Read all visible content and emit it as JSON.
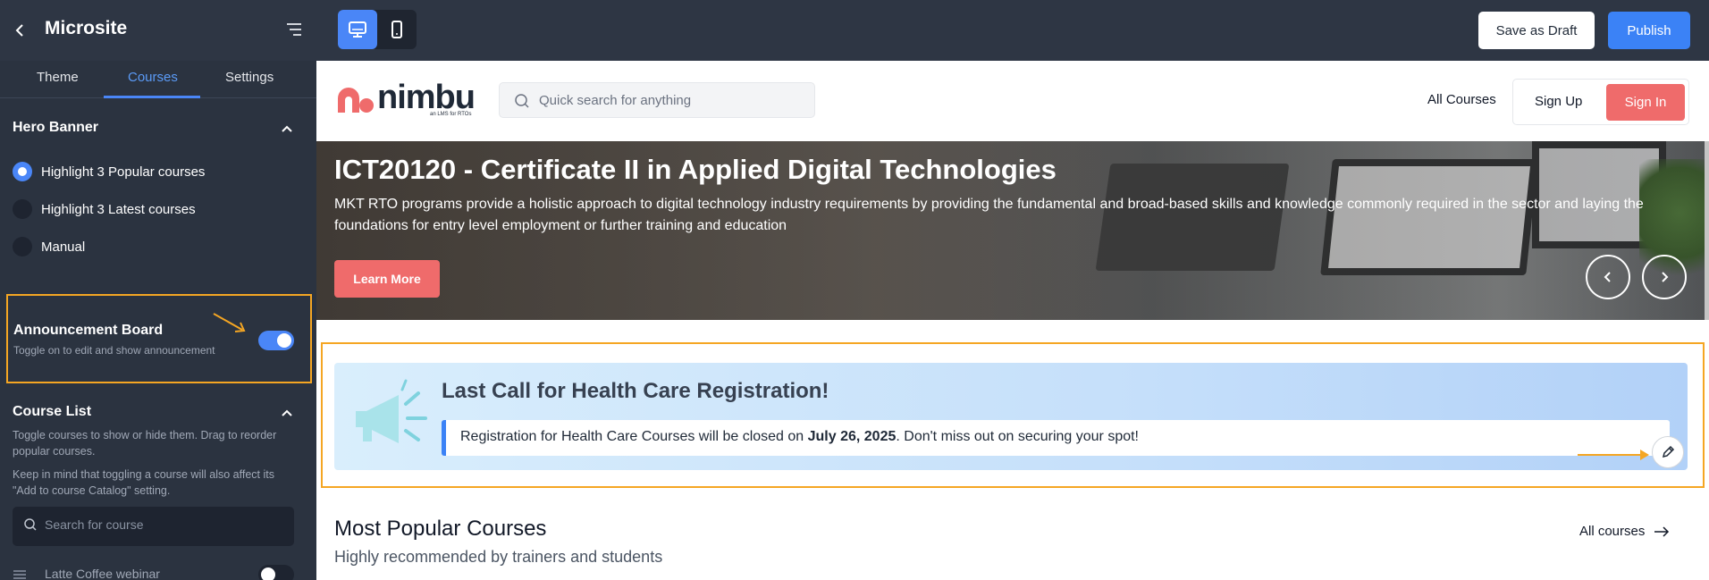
{
  "app": {
    "title": "Microsite",
    "save_draft_label": "Save as Draft",
    "publish_label": "Publish"
  },
  "sidebar": {
    "tabs": [
      {
        "label": "Theme"
      },
      {
        "label": "Courses",
        "active": true
      },
      {
        "label": "Settings"
      }
    ],
    "hero_banner": {
      "title": "Hero Banner",
      "options": [
        {
          "label": "Highlight 3 Popular courses",
          "checked": true
        },
        {
          "label": "Highlight 3 Latest courses",
          "checked": false
        },
        {
          "label": "Manual",
          "checked": false
        }
      ]
    },
    "announcement": {
      "title": "Announcement Board",
      "subtitle": "Toggle on to edit and show announcement",
      "enabled": true
    },
    "course_list": {
      "title": "Course List",
      "desc1": "Toggle courses to show or hide them. Drag to reorder popular courses.",
      "desc2": "Keep in mind that toggling a course will also affect its \"Add to course Catalog\" setting.",
      "search_placeholder": "Search for course",
      "items": [
        {
          "label": "Latte Coffee webinar",
          "enabled": false
        }
      ]
    }
  },
  "site": {
    "logo_text": "nimbu",
    "logo_tagline": "an LMS for RTOs",
    "search_placeholder": "Quick search for anything",
    "nav_all_courses": "All Courses",
    "signup_label": "Sign Up",
    "signin_label": "Sign In",
    "hero": {
      "title": "ICT20120 - Certificate II in Applied Digital Technologies",
      "description": "MKT RTO programs provide a holistic approach to digital technology industry requirements by providing the fundamental and broad-based skills and knowledge commonly required in the sector and laying the foundations for entry level employment or further training and education",
      "cta_label": "Learn More"
    },
    "announcement": {
      "heading": "Last Call for Health Care Registration!",
      "message_prefix": "Registration for Health Care Courses will be closed on ",
      "message_date": "July 26, 2025",
      "message_suffix": ". Don't miss out on securing your spot!"
    },
    "popular": {
      "title": "Most Popular Courses",
      "subtitle": "Highly recommended by trainers and students",
      "all_label": "All courses"
    }
  },
  "colors": {
    "accent": "#4a86f7",
    "highlight_border": "#f5a623",
    "cta": "#ef6b6b"
  }
}
